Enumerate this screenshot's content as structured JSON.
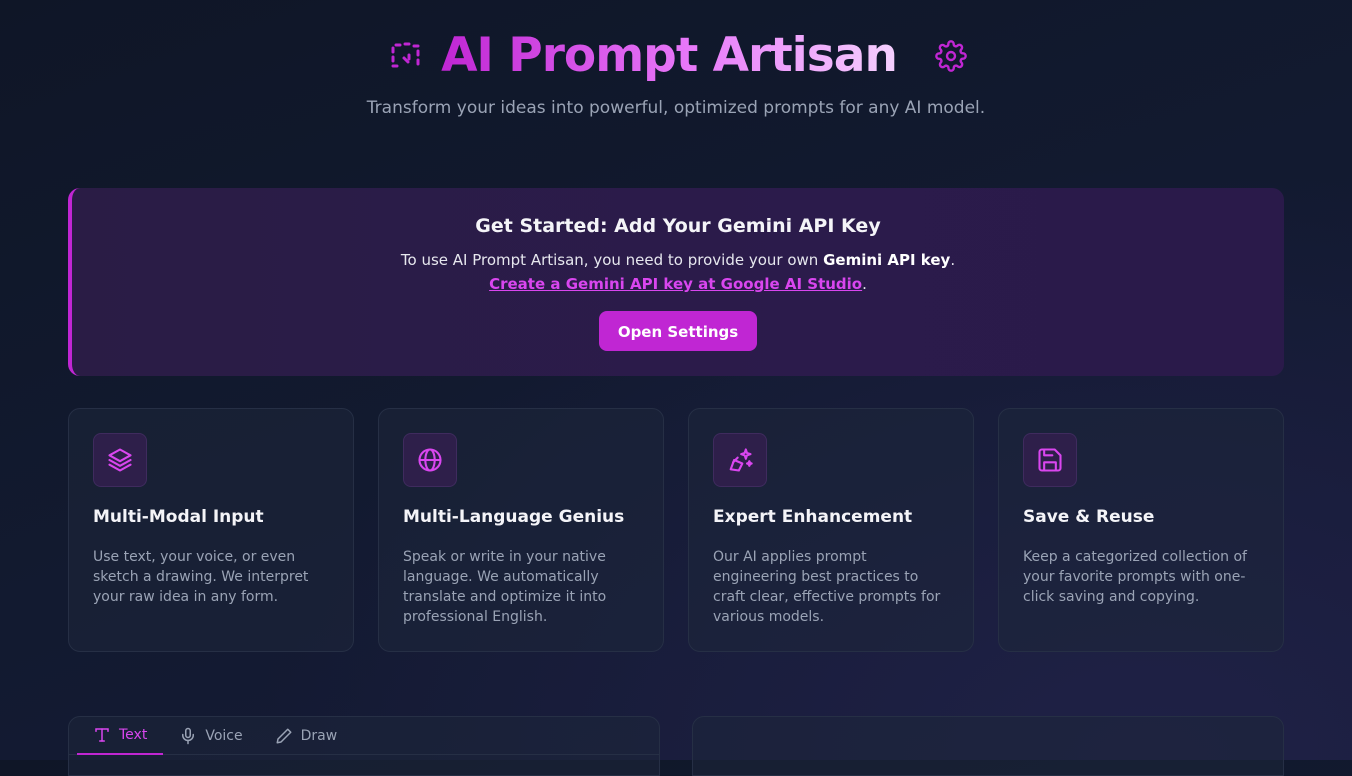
{
  "header": {
    "title": "AI Prompt Artisan",
    "subtitle": "Transform your ideas into powerful, optimized prompts for any AI model.",
    "logo_icon": "dotted-arrows-icon",
    "settings_icon": "gear-icon"
  },
  "banner": {
    "title": "Get Started: Add Your Gemini API Key",
    "text_prefix": "To use AI Prompt Artisan, you need to provide your own ",
    "text_bold": "Gemini API key",
    "text_suffix": ".",
    "link_text": "Create a Gemini API key at Google AI Studio",
    "link_suffix": ".",
    "button_label": "Open Settings"
  },
  "features": [
    {
      "icon": "layers-icon",
      "title": "Multi-Modal Input",
      "description": "Use text, your voice, or even sketch a drawing. We interpret your raw idea in any form."
    },
    {
      "icon": "globe-icon",
      "title": "Multi-Language Genius",
      "description": "Speak or write in your native language. We automatically translate and optimize it into professional English."
    },
    {
      "icon": "wand-sparkles-icon",
      "title": "Expert Enhancement",
      "description": "Our AI applies prompt engineering best practices to craft clear, effective prompts for various models."
    },
    {
      "icon": "save-icon",
      "title": "Save & Reuse",
      "description": "Keep a categorized collection of your favorite prompts with one-click saving and copying."
    }
  ],
  "input_tabs": [
    {
      "label": "Text",
      "icon": "type-icon",
      "active": true
    },
    {
      "label": "Voice",
      "icon": "microphone-icon",
      "active": false
    },
    {
      "label": "Draw",
      "icon": "pencil-icon",
      "active": false
    }
  ],
  "colors": {
    "accent": "#c026d3",
    "accent_light": "#d946ef",
    "background": "#111827"
  }
}
